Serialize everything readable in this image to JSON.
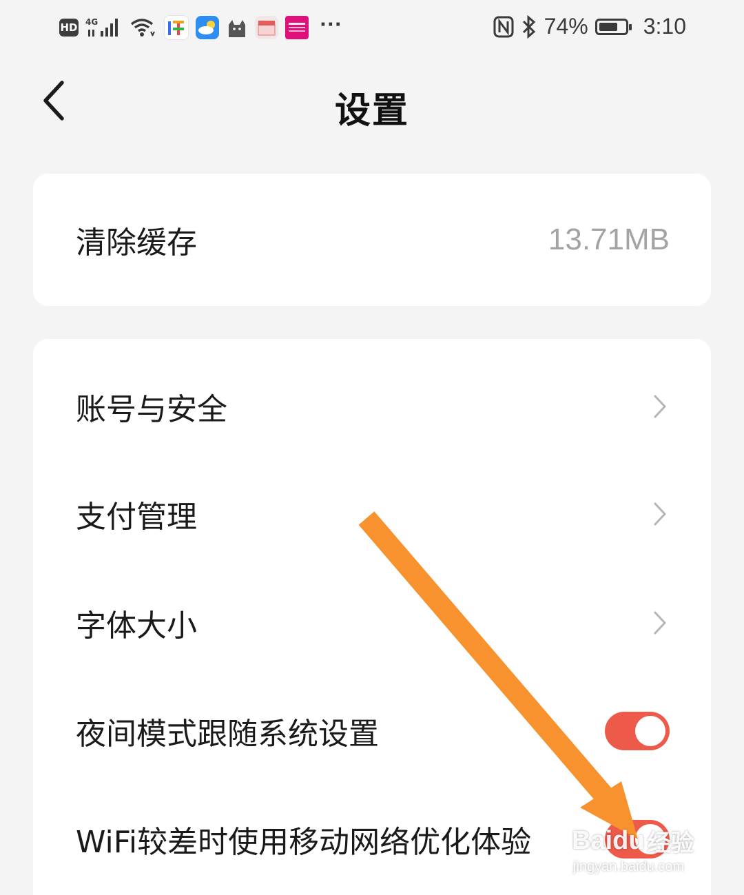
{
  "status_bar": {
    "hd_label": "HD",
    "network_label": "4G",
    "app_icons": [
      "jia-app-icon",
      "weather-app-icon",
      "cat-app-icon",
      "box-app-icon",
      "vip-app-icon"
    ],
    "more": "···",
    "battery_percent": "74%",
    "battery_level": 0.74,
    "time": "3:10"
  },
  "header": {
    "title": "设置"
  },
  "cache": {
    "label": "清除缓存",
    "value": "13.71MB"
  },
  "settings": {
    "items": [
      {
        "label": "账号与安全",
        "type": "link"
      },
      {
        "label": "支付管理",
        "type": "link"
      },
      {
        "label": "字体大小",
        "type": "link"
      },
      {
        "label": "夜间模式跟随系统设置",
        "type": "toggle",
        "on": true
      },
      {
        "label": "WiFi较差时使用移动网络优化体验",
        "type": "toggle",
        "on": true
      }
    ]
  },
  "colors": {
    "toggle_on": "#ee5a4a",
    "arrow": "#f7922e",
    "background": "#f4f4f4"
  },
  "watermark": {
    "brand": "Baidu",
    "brand_cn": "经验",
    "url": "jingyan.baidu.com"
  }
}
